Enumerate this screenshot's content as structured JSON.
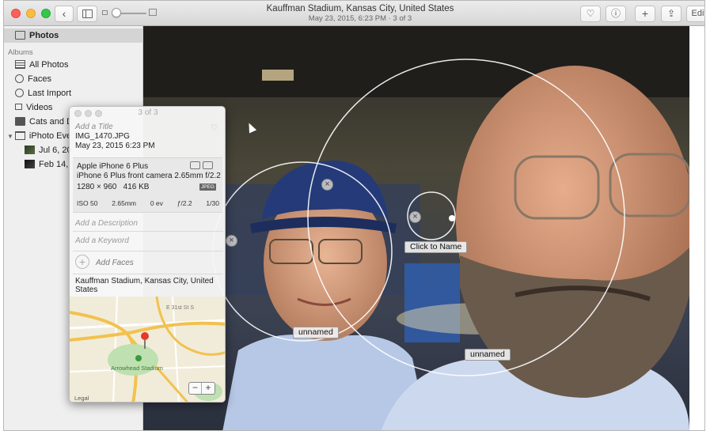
{
  "window": {
    "title": "Kauffman Stadium, Kansas City, United States",
    "subtitle": "May 23, 2015, 6:23 PM  ·  3 of 3"
  },
  "toolbar": {
    "back_icon": "‹",
    "heart_icon": "♡",
    "info_icon": "ⓘ",
    "add_icon": "+",
    "share_icon": "⇪",
    "edit_label": "Edit",
    "zoom_level": 0
  },
  "sidebar": {
    "top_item": "Photos",
    "section_label": "Albums",
    "items": [
      {
        "label": "All Photos",
        "icon": "all-photos-icon"
      },
      {
        "label": "Faces",
        "icon": "faces-icon"
      },
      {
        "label": "Last Import",
        "icon": "last-import-icon"
      },
      {
        "label": "Videos",
        "icon": "videos-icon"
      },
      {
        "label": "Cats and D",
        "icon": "album-icon"
      },
      {
        "label": "iPhoto Eve",
        "icon": "folder-icon"
      },
      {
        "label": "Jul 6, 20",
        "icon": "event-thumb-icon"
      },
      {
        "label": "Feb 14, 2",
        "icon": "event-thumb-icon"
      }
    ]
  },
  "viewer": {
    "faces": [
      {
        "label": "unnamed"
      },
      {
        "label": "Click to Name"
      },
      {
        "label": "unnamed"
      }
    ],
    "close_icon": "×"
  },
  "info_panel": {
    "counter": "3 of 3",
    "title_placeholder": "Add a Title",
    "heart_icon": "♡",
    "filename": "IMG_1470.JPG",
    "date": "May 23, 2015   6:23 PM",
    "camera_model": "Apple iPhone 6 Plus",
    "lens": "iPhone 6 Plus front camera 2.65mm f/2.2",
    "dimensions": "1280 × 960",
    "filesize": "416 KB",
    "format_badge": "JPEG",
    "exif": {
      "iso": "ISO 50",
      "focal": "2.65mm",
      "ev": "0 ev",
      "aperture": "ƒ/2.2",
      "shutter": "1/30"
    },
    "description_placeholder": "Add a Description",
    "keyword_placeholder": "Add a Keyword",
    "add_faces_label": "Add Faces",
    "add_faces_icon": "+",
    "location": "Kauffman Stadium, Kansas City, United States",
    "map": {
      "street_label": "E 31st St S",
      "place_label": "Arrowhead Stadium",
      "legal_label": "Legal",
      "zoom_out": "−",
      "zoom_in": "+"
    }
  },
  "colors": {
    "accent_red": "#fc605c",
    "accent_yellow": "#fdbc40",
    "accent_green": "#34c84a",
    "sidebar_bg": "#efefef",
    "map_pin": "#e53a2a"
  }
}
